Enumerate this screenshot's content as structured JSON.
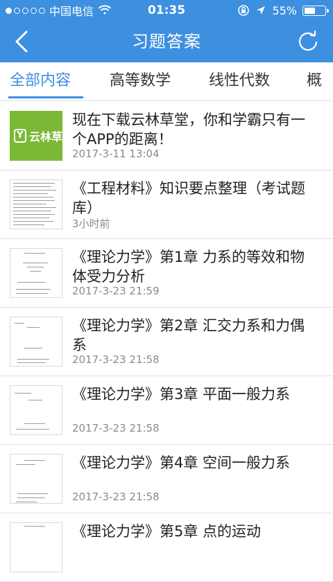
{
  "status_bar": {
    "carrier": "中国电信",
    "time": "01:35",
    "battery_text": "55%",
    "battery_level": 0.55,
    "signal_dots_filled": 1,
    "icons": [
      "wifi-icon",
      "orientation-lock-icon",
      "location-arrow-icon",
      "battery-icon"
    ]
  },
  "nav": {
    "title": "习题答案",
    "back_icon": "chevron-left-icon",
    "refresh_icon": "refresh-icon"
  },
  "tabs": [
    {
      "label": "全部内容",
      "active": true
    },
    {
      "label": "高等数学",
      "active": false
    },
    {
      "label": "线性代数",
      "active": false
    },
    {
      "label": "概",
      "active": false
    }
  ],
  "items": [
    {
      "title": "现在下载云林草堂，你和学霸只有一个APP的距离！",
      "time": "2017-3-11 13:04",
      "thumb": "app-logo",
      "logo_text": "云林草"
    },
    {
      "title": "《工程材料》知识要点整理（考试题库）",
      "time": "3小时前",
      "thumb": "document"
    },
    {
      "title": "《理论力学》第1章  力系的等效和物体受力分析",
      "time": "2017-3-23 21:59",
      "thumb": "document"
    },
    {
      "title": "《理论力学》第2章  汇交力系和力偶系",
      "time": "2017-3-23 21:58",
      "thumb": "document"
    },
    {
      "title": "《理论力学》第3章  平面一般力系",
      "time": "2017-3-23 21:58",
      "thumb": "document"
    },
    {
      "title": "《理论力学》第4章  空间一般力系",
      "time": "2017-3-23 21:58",
      "thumb": "document"
    },
    {
      "title": "《理论力学》第5章  点的运动",
      "time": "",
      "thumb": "document"
    }
  ],
  "colors": {
    "brand": "#3d8fe0",
    "logo_green": "#7bb835"
  }
}
